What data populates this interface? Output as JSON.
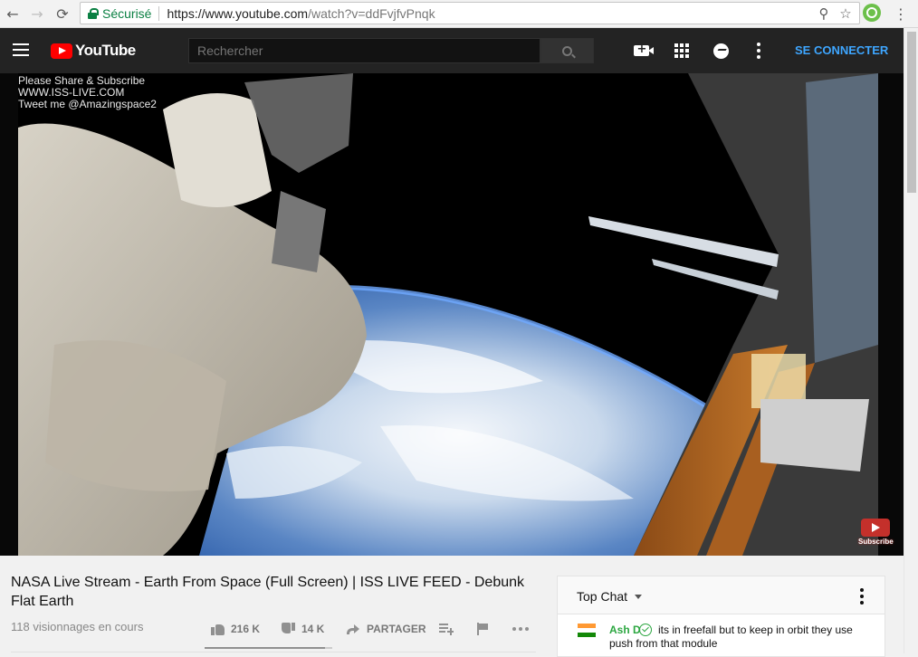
{
  "browser": {
    "secure_label": "Sécurisé",
    "url_host": "https://www.youtube.com",
    "url_rest": "/watch?v=ddFvjfvPnqk",
    "back_icon": "←",
    "forward_icon": "→",
    "reload_icon": "⟳",
    "zoom_icon": "⚲",
    "star_icon": "☆",
    "menu_icon": "⋮"
  },
  "header": {
    "logo_text": "YouTube",
    "search_placeholder": "Rechercher",
    "signin_label": "SE CONNECTER"
  },
  "video": {
    "overlay_lines": [
      "Please Share & Subscribe",
      "WWW.ISS-LIVE.COM",
      "Tweet me @Amazingspace2"
    ],
    "subscribe_label": "Subscribe"
  },
  "info": {
    "title": "NASA Live Stream - Earth From Space (Full Screen) | ISS LIVE FEED - Debunk Flat Earth",
    "views": "118 visionnages en cours",
    "likes": "216 K",
    "dislikes": "14 K",
    "share_label": "PARTAGER",
    "like_ratio": 0.94
  },
  "chat": {
    "mode": "Top Chat",
    "message": {
      "author": "Ash D",
      "text": "its in freefall but to keep in orbit they use push from that module"
    }
  },
  "colors": {
    "brand_red": "#ff0000",
    "link_blue": "#3ea6ff",
    "chat_author": "#2ba640"
  }
}
